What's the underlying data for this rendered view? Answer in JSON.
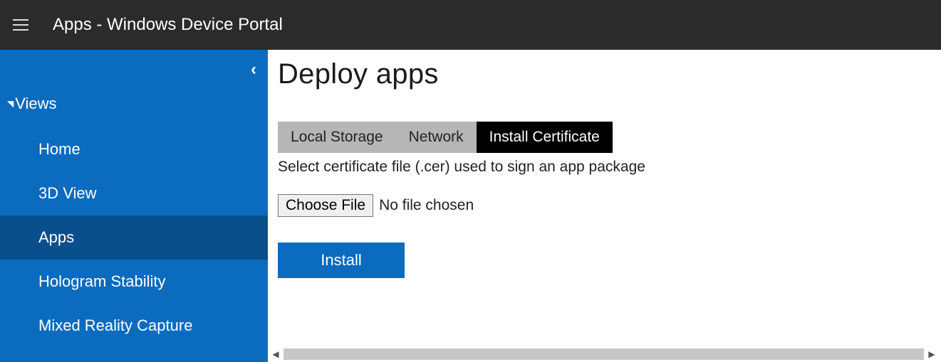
{
  "header": {
    "title": "Apps - Windows Device Portal"
  },
  "sidebar": {
    "group_label": "Views",
    "items": [
      {
        "label": "Home",
        "selected": false
      },
      {
        "label": "3D View",
        "selected": false
      },
      {
        "label": "Apps",
        "selected": true
      },
      {
        "label": "Hologram Stability",
        "selected": false
      },
      {
        "label": "Mixed Reality Capture",
        "selected": false
      }
    ]
  },
  "main": {
    "page_title": "Deploy apps",
    "tabs": [
      {
        "label": "Local Storage",
        "active": false
      },
      {
        "label": "Network",
        "active": false
      },
      {
        "label": "Install Certificate",
        "active": true
      }
    ],
    "instruction": "Select certificate file (.cer) used to sign an app package",
    "file_picker": {
      "button_label": "Choose File",
      "status_text": "No file chosen"
    },
    "install_button_label": "Install"
  }
}
